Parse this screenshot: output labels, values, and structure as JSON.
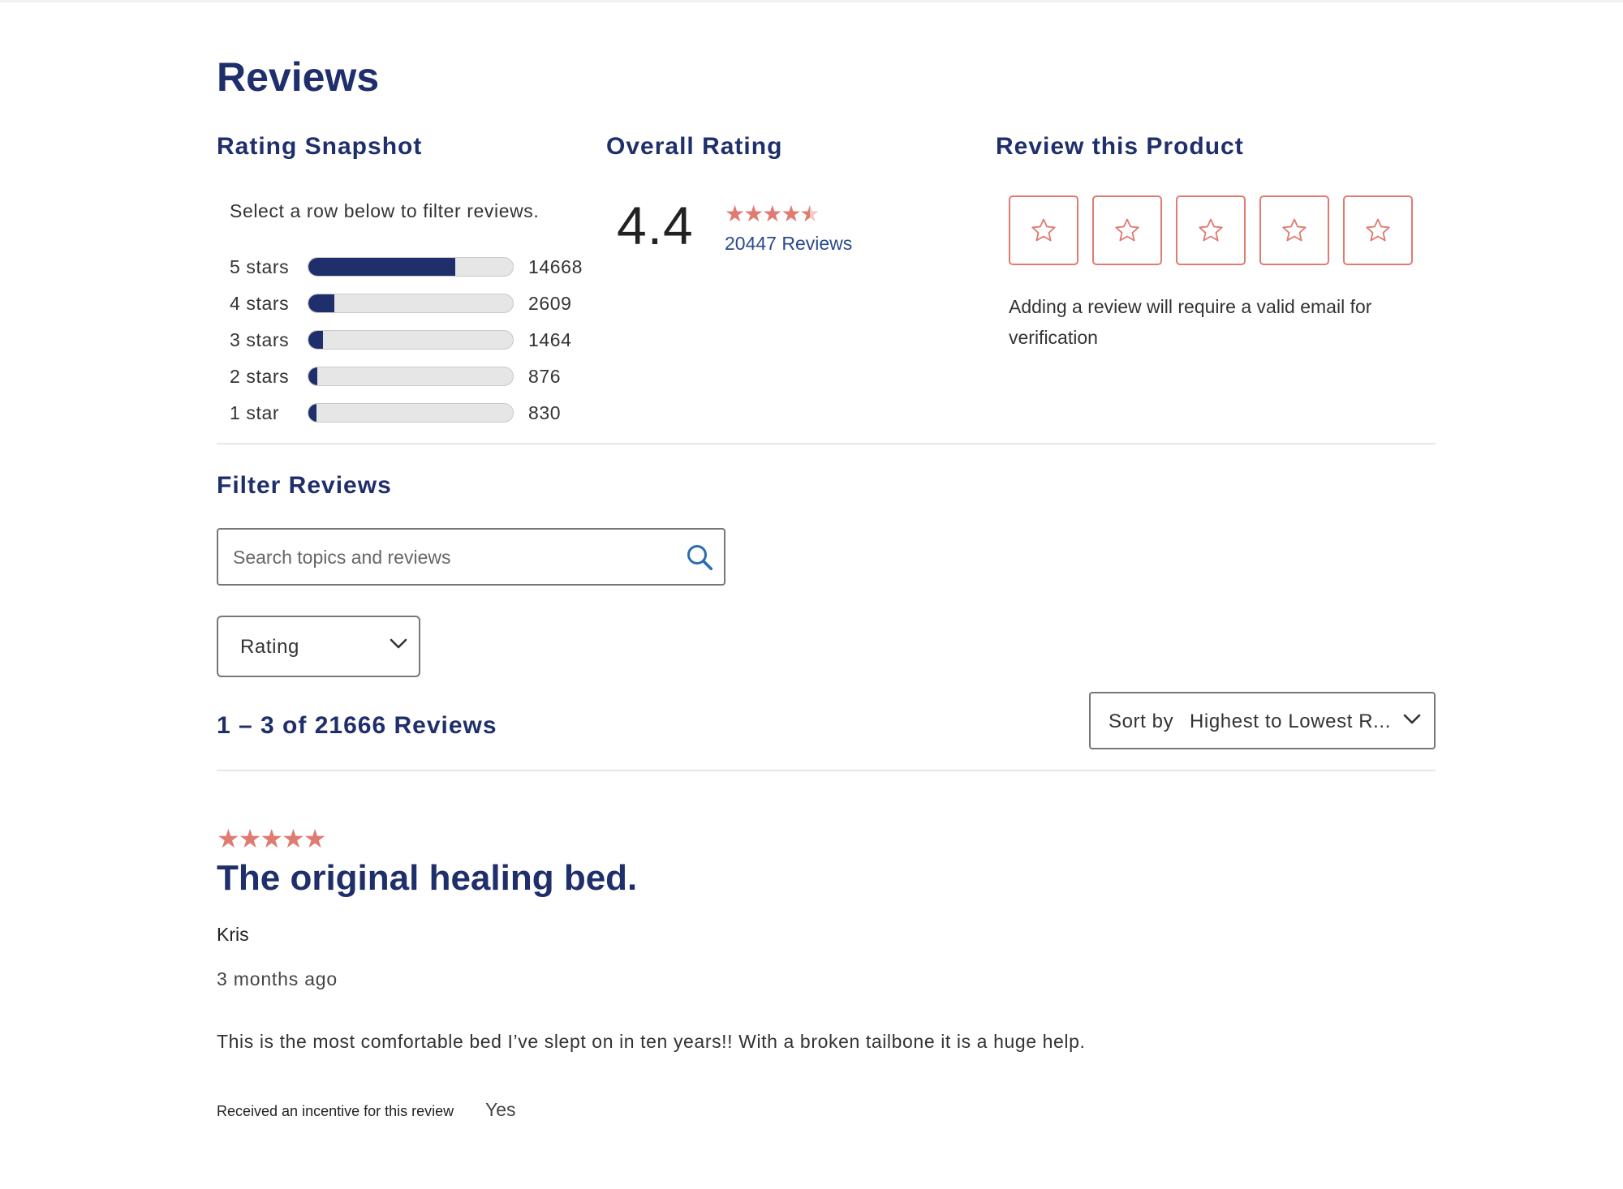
{
  "page": {
    "title": "Reviews"
  },
  "colors": {
    "brand_navy": "#1f2f6b",
    "star_coral": "#e07b72",
    "link_blue": "#2b4a8b"
  },
  "snapshot": {
    "heading": "Rating Snapshot",
    "instruction": "Select a row below to filter reviews.",
    "rows": [
      {
        "label": "5 stars",
        "count": "14668",
        "fraction": 0.718
      },
      {
        "label": "4 stars",
        "count": "2609",
        "fraction": 0.128
      },
      {
        "label": "3 stars",
        "count": "1464",
        "fraction": 0.072
      },
      {
        "label": "2 stars",
        "count": "876",
        "fraction": 0.043
      },
      {
        "label": "1 star",
        "count": "830",
        "fraction": 0.041
      }
    ]
  },
  "overall": {
    "heading": "Overall Rating",
    "value": "4.4",
    "stars_value": 4.4,
    "review_count_text": "20447 Reviews"
  },
  "review_product": {
    "heading": "Review this Product",
    "star_boxes": [
      "star-outline-icon",
      "star-outline-icon",
      "star-outline-icon",
      "star-outline-icon",
      "star-outline-icon"
    ],
    "note": "Adding a review will require a valid email for verification"
  },
  "filter": {
    "heading": "Filter Reviews",
    "search_placeholder": "Search topics and reviews",
    "search_icon": "search-icon",
    "rating_select_label": "Rating"
  },
  "results": {
    "count_text": "1 – 3 of 21666 Reviews",
    "sort_prefix": "Sort by",
    "sort_value": "Highest to Lowest R..."
  },
  "reviews": [
    {
      "stars": 5,
      "title": "The original healing bed.",
      "author": "Kris",
      "date": "3 months ago",
      "body": "This is the most comfortable bed I’ve slept on in ten years!! With a broken tailbone it is a huge help.",
      "incentive_label": "Received an incentive for this review",
      "incentive_value": "Yes"
    }
  ]
}
